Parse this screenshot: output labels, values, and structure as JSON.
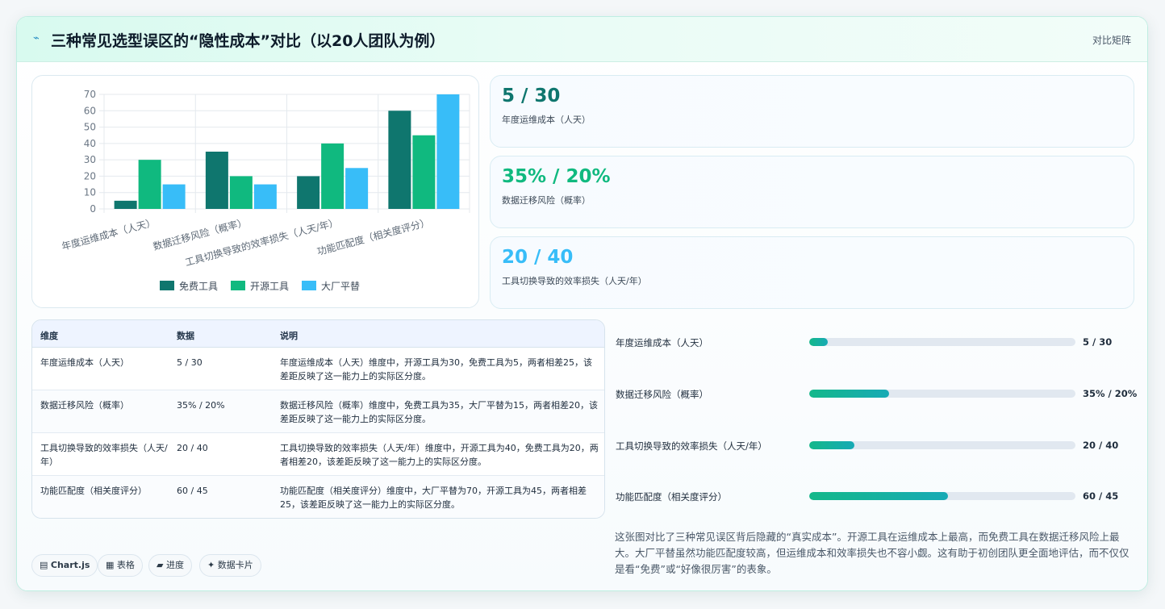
{
  "header": {
    "title": "三种常见选型误区的“隐性成本”对比（以20人团队为例）",
    "tag": "对比矩阵"
  },
  "chart_data": {
    "type": "bar",
    "categories": [
      "年度运维成本（人天）",
      "数据迁移风险（概率）",
      "工具切换导致的效率损失（人天/年）",
      "功能匹配度（相关度评分）"
    ],
    "series": [
      {
        "name": "免费工具",
        "color": "#0f766e",
        "values": [
          5,
          35,
          20,
          60
        ]
      },
      {
        "name": "开源工具",
        "color": "#10b97f",
        "values": [
          30,
          20,
          40,
          45
        ]
      },
      {
        "name": "大厂平替",
        "color": "#38bdf8",
        "values": [
          15,
          15,
          25,
          70
        ]
      }
    ],
    "ylim": [
      0,
      70
    ],
    "yticks": [
      0,
      10,
      20,
      30,
      40,
      50,
      60,
      70
    ],
    "legend": "bottom",
    "grid": true
  },
  "stats": [
    {
      "value": "5 / 30",
      "label": "年度运维成本（人天）",
      "color": "#0f766e"
    },
    {
      "value": "35% / 20%",
      "label": "数据迁移风险（概率）",
      "color": "#10b97f"
    },
    {
      "value": "20 / 40",
      "label": "工具切换导致的效率损失（人天/年）",
      "color": "#38bdf8"
    }
  ],
  "table": {
    "headers": [
      "维度",
      "数据",
      "说明"
    ],
    "rows": [
      {
        "dim": "年度运维成本（人天）",
        "data": "5 / 30",
        "note": "年度运维成本（人天）维度中，开源工具为30，免费工具为5，两者相差25，该差距反映了这一能力上的实际区分度。"
      },
      {
        "dim": "数据迁移风险（概率）",
        "data": "35% / 20%",
        "note": "数据迁移风险（概率）维度中，免费工具为35，大厂平替为15，两者相差20，该差距反映了这一能力上的实际区分度。"
      },
      {
        "dim": "工具切换导致的效率损失（人天/年）",
        "data": "20 / 40",
        "note": "工具切换导致的效率损失（人天/年）维度中，开源工具为40，免费工具为20，两者相差20，该差距反映了这一能力上的实际区分度。"
      },
      {
        "dim": "功能匹配度（相关度评分）",
        "data": "60 / 45",
        "note": "功能匹配度（相关度评分）维度中，大厂平替为70，开源工具为45，两者相差25，该差距反映了这一能力上的实际区分度。"
      }
    ]
  },
  "progress": [
    {
      "label": "年度运维成本（人天）",
      "value": "5 / 30",
      "fraction": 0.07
    },
    {
      "label": "数据迁移风险（概率）",
      "value": "35% / 20%",
      "fraction": 0.3
    },
    {
      "label": "工具切换导致的效率损失（人天/年）",
      "value": "20 / 40",
      "fraction": 0.17
    },
    {
      "label": "功能匹配度（相关度评分）",
      "value": "60 / 45",
      "fraction": 0.52
    }
  ],
  "summary": "这张图对比了三种常见误区背后隐藏的“真实成本”。开源工具在运维成本上最高，而免费工具在数据迁移风险上最大。大厂平替虽然功能匹配度较高，但运维成本和效率损失也不容小觑。这有助于初创团队更全面地评估，而不仅仅是看“免费”或“好像很厉害”的表象。",
  "chips": [
    {
      "icon": "▤",
      "label": "Chart.js",
      "icon_name": "chart-icon"
    },
    {
      "icon": "▦",
      "label": "表格",
      "icon_name": "table-icon"
    },
    {
      "icon": "▰",
      "label": "进度",
      "icon_name": "progress-icon"
    },
    {
      "icon": "✦",
      "label": "数据卡片",
      "icon_name": "sparkle-icon"
    }
  ]
}
